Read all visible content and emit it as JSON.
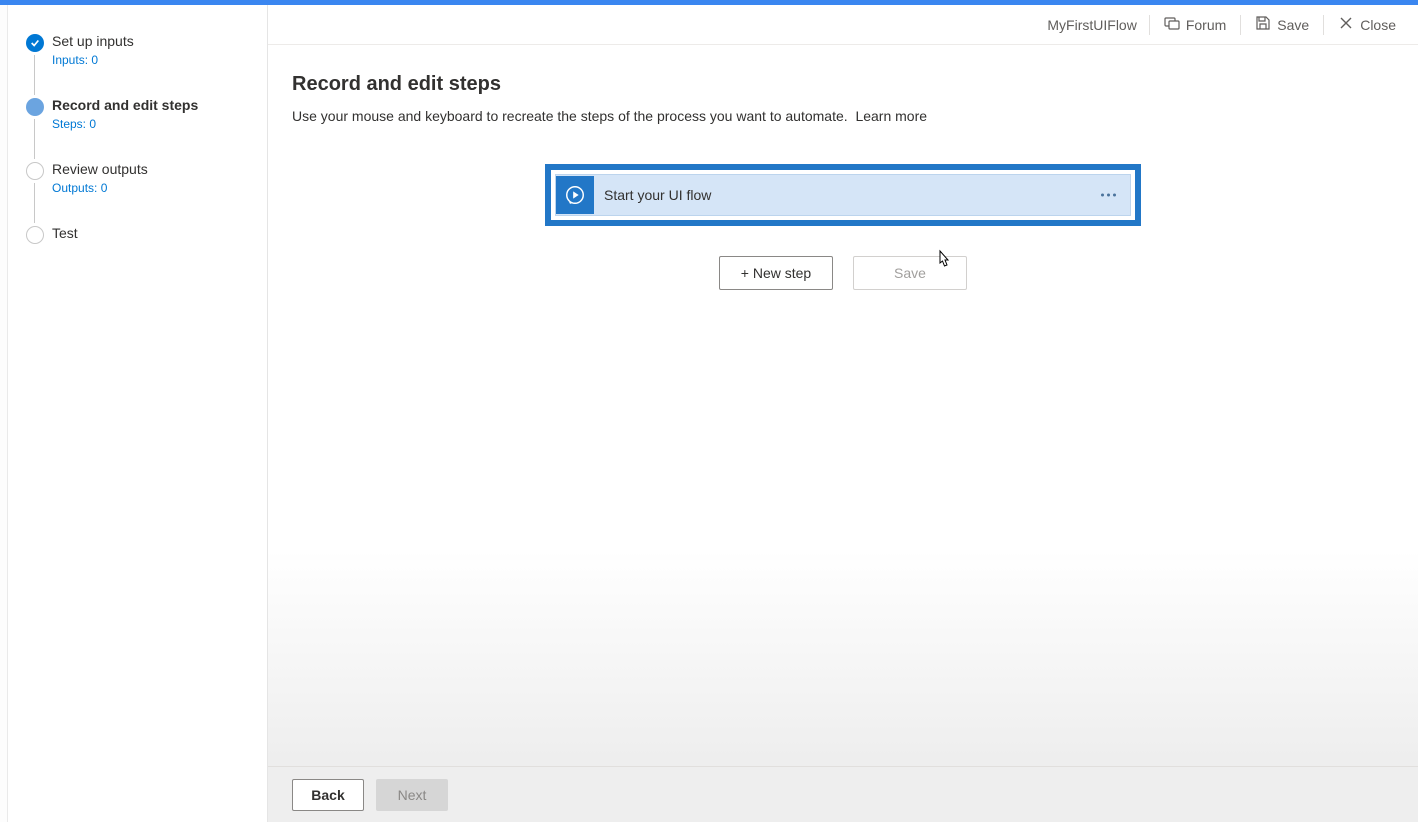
{
  "header": {
    "flowName": "MyFirstUIFlow",
    "forum": "Forum",
    "save": "Save",
    "close": "Close"
  },
  "sidebar": {
    "steps": [
      {
        "title": "Set up inputs",
        "subtitle": "Inputs: 0"
      },
      {
        "title": "Record and edit steps",
        "subtitle": "Steps: 0"
      },
      {
        "title": "Review outputs",
        "subtitle": "Outputs: 0"
      },
      {
        "title": "Test",
        "subtitle": ""
      }
    ]
  },
  "main": {
    "title": "Record and edit steps",
    "description": "Use your mouse and keyboard to recreate the steps of the process you want to automate.",
    "learnMore": "Learn more",
    "flowCardLabel": "Start your UI flow",
    "newStep": "+ New step",
    "savePanel": "Save"
  },
  "footer": {
    "back": "Back",
    "next": "Next"
  }
}
